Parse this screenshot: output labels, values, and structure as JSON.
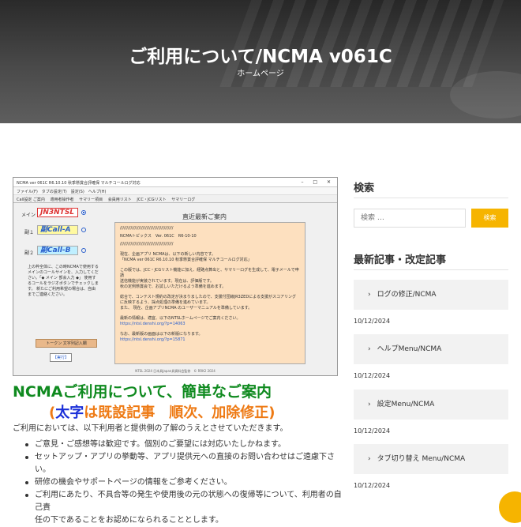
{
  "hero": {
    "title": "ご利用について/NCMA v061C",
    "breadcrumb": "ホームページ"
  },
  "screenshot": {
    "window_title": "NCMA ver 061C R6.10.10 秋季懸賞合評確保 マルチコールログ対応",
    "window_controls": "– □ ✕",
    "menu": "ファイル(F)　タブの設定(T)　設定(S)　ヘルプ(H)",
    "tabs": [
      "Call設定 ご案内",
      "適用者操作者",
      "サマリー項目",
      "会員用リスト",
      "JCC・JCGリスト",
      "サマリーログ"
    ],
    "main_label": "メイン",
    "main_call": "JN3NTSL",
    "sub1_label": "副１",
    "sub1_call": "副Call-A",
    "sub2_label": "副２",
    "sub2_call": "副Call-B",
    "note": "上の枠全体に、この時NCMAで使用するメインのコールサインを、入力してください。「◆ メイン 部会入力 ◆」 使用するコールをラジオボタンでチェックします。 新たにご利用希望の場合は、自由までご連絡ください。",
    "token_button": "トークン 文字列記入欄",
    "run_button": "【実行】",
    "panel_title": "直近最新ご案内",
    "panel_lines": [
      "////////////////////////////////////////",
      "NCMAトピックス　Ver. 061C　R6-10-10",
      "////////////////////////////////////////",
      "現在、企画アプリ NCMAは、以下の新しい内容です。",
      "「NCMA ver 061C R6.10.10 秋季懸賞合評確保 マルチコールログ対応」",
      "この版では、JCC・JCGリスト機能に加え、経路点算出と、サマリーログを生成して、電子メールで申請",
      "送信機能が実装されています。現在は、評価版です。",
      "秋の定例懸賞会で、お試しいただけるよう準備を進めます。",
      "総合で、コンテスト規約の改定が決まりましたので、支援付団線JR3ZEDによる支援がスコアリングに反映するよう、採点処理の準備を進めています。",
      "また、 現在、企画アプリNCMA のユーザーマニュアルを準備しています。",
      "最新の情報は、適宜、以下のNTSLホームページでご案内ください。"
    ],
    "panel_link1": "https://ntsl.denshi.org/?p=14063",
    "panel_line_after": "なお、最新版の画面は以下の新版になります。",
    "panel_link2": "https://ntsl.denshi.org/?p=15871",
    "status": "NTSL 2024 日本具Japan具資料会監修　© RRK2 2024"
  },
  "article": {
    "heading1": "NCMAご利用について、簡単なご案内",
    "heading2_paren_open": "(",
    "heading2_bold": "太字",
    "heading2_mid": "は既設記事　順次、加除修正",
    "heading2_paren_close": ")",
    "intro": "ご利用においては、以下利用者と提供側の了解のうえとさせていただきます。",
    "bullets": [
      "ご意見・ご感想等は歓迎です。個別のご要望には対応いたしかねます。",
      "セットアップ・アプリの挙動等、アプリ提供元への直接のお問い合わせはご遠慮下さい。",
      "研修の機会やサポートページの情報をご参考ください。",
      "ご利用にあたり、不具合等の発生や使用後の元の状態への復帰等について、利用者の自己責",
      "任の下であることをお認めになられることとします。"
    ]
  },
  "sidebar": {
    "search_heading": "検索",
    "search_placeholder": "検索 …",
    "search_button": "検索",
    "recent_heading": "最新記事・改定記事",
    "posts": [
      {
        "title": "ログの修正/NCMA",
        "date": "10/12/2024"
      },
      {
        "title": "ヘルプMenu/NCMA",
        "date": "10/12/2024"
      },
      {
        "title": "設定Menu/NCMA",
        "date": "10/12/2024"
      },
      {
        "title": "タブ切り替え Menu/NCMA",
        "date": "10/12/2024"
      }
    ]
  },
  "colors": {
    "accent": "#f6b400",
    "heading_green": "#0f8a1f",
    "heading_orange": "#ee7a14",
    "heading_blue": "#1a2fd8"
  }
}
